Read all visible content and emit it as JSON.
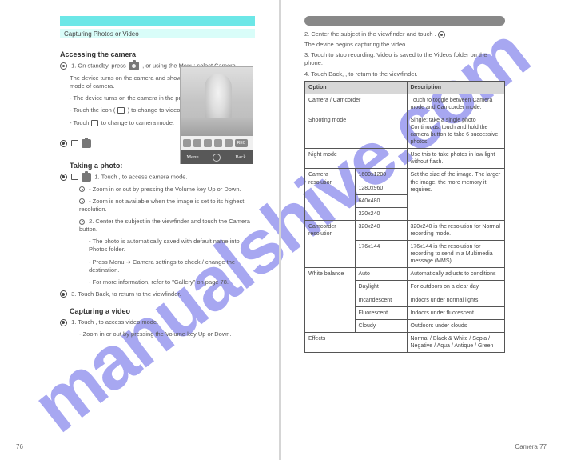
{
  "watermark": "manualshive.com",
  "left": {
    "subheader": "Capturing Photos or Video",
    "section_title": "Accessing the camera",
    "step1_before": "1. On standby, press",
    "step1_after": ", or using the Menu: select Camera.",
    "line2": "The device turns on the camera and shows the preview with a default mode of camera.",
    "line3a": "- The device turns on the camera in the previously selected mode.",
    "line3b": "- Touch the icon (",
    "line3c": ") to change to video mode.",
    "line4a": "- Touch",
    "line4b": "to change to camera mode.",
    "sub_a": "Taking a photo:",
    "a1": "1. Touch , to access camera mode.",
    "a2a": "- Zoom in or out by pressing the Volume key Up or Down.",
    "a2b": "- Zoom is not available when the image is set to its highest resolution.",
    "a3": "2. Center the subject in the viewfinder and touch the Camera button.",
    "a3a": "- The photo is automatically saved with default name into Photos folder.",
    "a3b": "- Press Menu ➔ Camera settings to check / change the destination.",
    "a3c": "- For more information, refer to \"Gallery\" on page 78.",
    "sub_b": "3. Touch Back, to return to the viewfinder.",
    "sub_b_head": "Capturing a video",
    "b1": "1. Touch , to access video mode.",
    "b1a": "- Zoom in or out by pressing the Volume key Up or Down.",
    "preview": {
      "menu": "Menu",
      "back": "Back",
      "rec": "REC"
    },
    "page_num": "76"
  },
  "right": {
    "intro_a": "2. Center the subject in the viewfinder and touch .",
    "intro_b": "The device begins capturing the video.",
    "step3": "3. Touch to stop recording. Video is saved to the Videos folder on the phone.",
    "step4": "4. Touch Back, , to return to the viewfinder.",
    "table": {
      "head": [
        "Option",
        "Description"
      ],
      "rows": [
        [
          "Camera / Camcorder",
          "Touch to toggle between Camera mode and Camcorder mode."
        ],
        [
          "Shooting mode",
          "Single: take a single photo\nContinuous: touch and hold the camera button to take 6 successive photos"
        ],
        [
          "Night mode",
          "Use this to take photos in low light without flash."
        ]
      ],
      "nested_head": "Camera resolution",
      "nested_rows": [
        [
          "1600x1200",
          "Set the size of the image. The larger the image, the more memory it requires."
        ],
        [
          "1280x960",
          ""
        ],
        [
          "640x480",
          ""
        ],
        [
          "320x240",
          ""
        ]
      ],
      "rows2_head": "Camcorder resolution",
      "rows2": [
        [
          "320x240",
          "320x240 is the resolution for Normal recording mode."
        ],
        [
          "176x144",
          "176x144 is the resolution for recording to send in a Multimedia message (MMS)."
        ]
      ],
      "wb_head": "White balance",
      "wb_rows": [
        [
          "Auto",
          "Automatically adjusts to conditions"
        ],
        [
          "Daylight",
          "For outdoors on a clear day"
        ],
        [
          "Incandescent",
          "Indoors under normal lights"
        ],
        [
          "Fluorescent",
          "Indoors under fluorescent"
        ],
        [
          "Cloudy",
          "Outdoors under clouds"
        ]
      ],
      "effects": [
        "Effects",
        "Normal / Black & White / Sepia / Negative / Aqua / Antique / Green"
      ]
    },
    "page_num": "Camera    77"
  }
}
